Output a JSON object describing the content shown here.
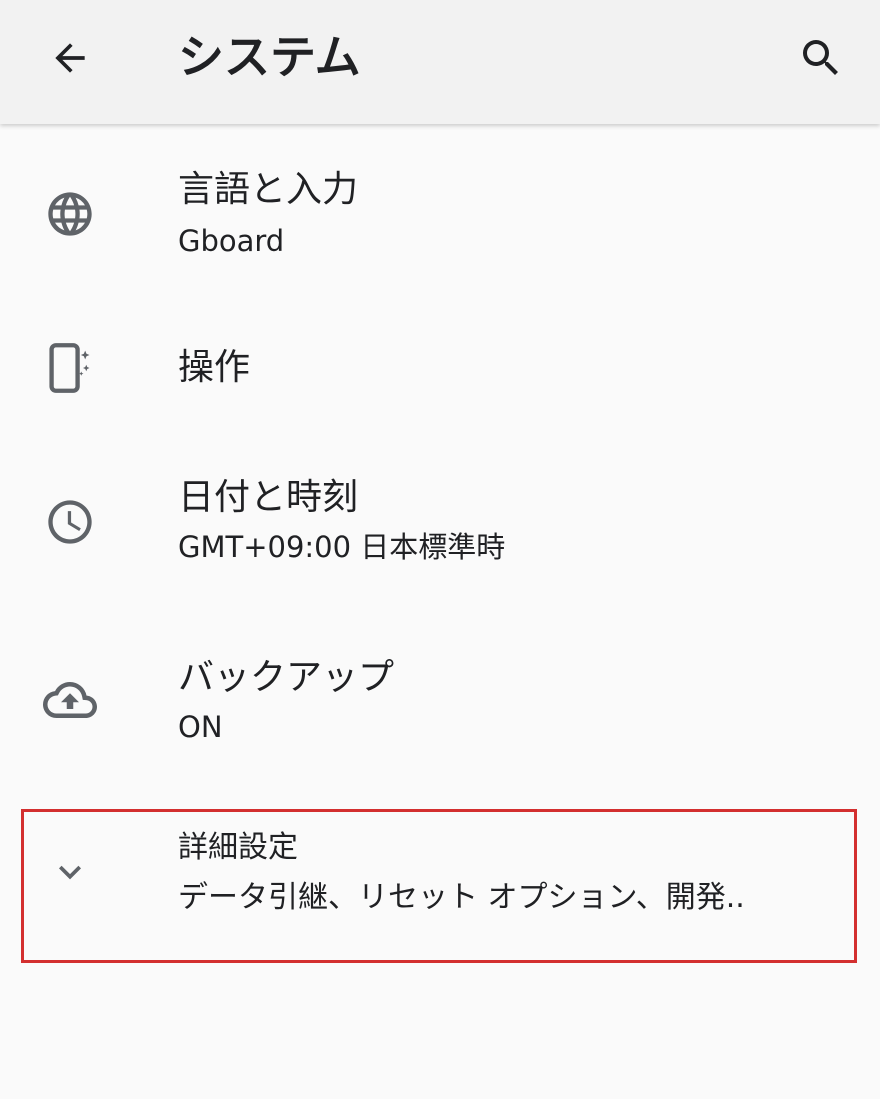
{
  "app_bar": {
    "title": "システム",
    "back_icon": "arrow-back-icon",
    "search_icon": "search-icon"
  },
  "items": [
    {
      "icon": "globe-icon",
      "title": "言語と入力",
      "summary": "Gboard"
    },
    {
      "icon": "phone-gesture-icon",
      "title": "操作",
      "summary": ""
    },
    {
      "icon": "clock-icon",
      "title": "日付と時刻",
      "summary": "GMT+09:00 日本標準時"
    },
    {
      "icon": "cloud-upload-icon",
      "title": "バックアップ",
      "summary": "ON"
    }
  ],
  "advanced": {
    "icon": "chevron-down-icon",
    "title": "詳細設定",
    "summary": "データ引継、リセット オプション、開発.."
  },
  "colors": {
    "icon": "#5f6368",
    "text": "#202124",
    "highlight": "#d32f2f",
    "app_bar_bg": "#f2f2f2",
    "page_bg": "#fafafa"
  }
}
